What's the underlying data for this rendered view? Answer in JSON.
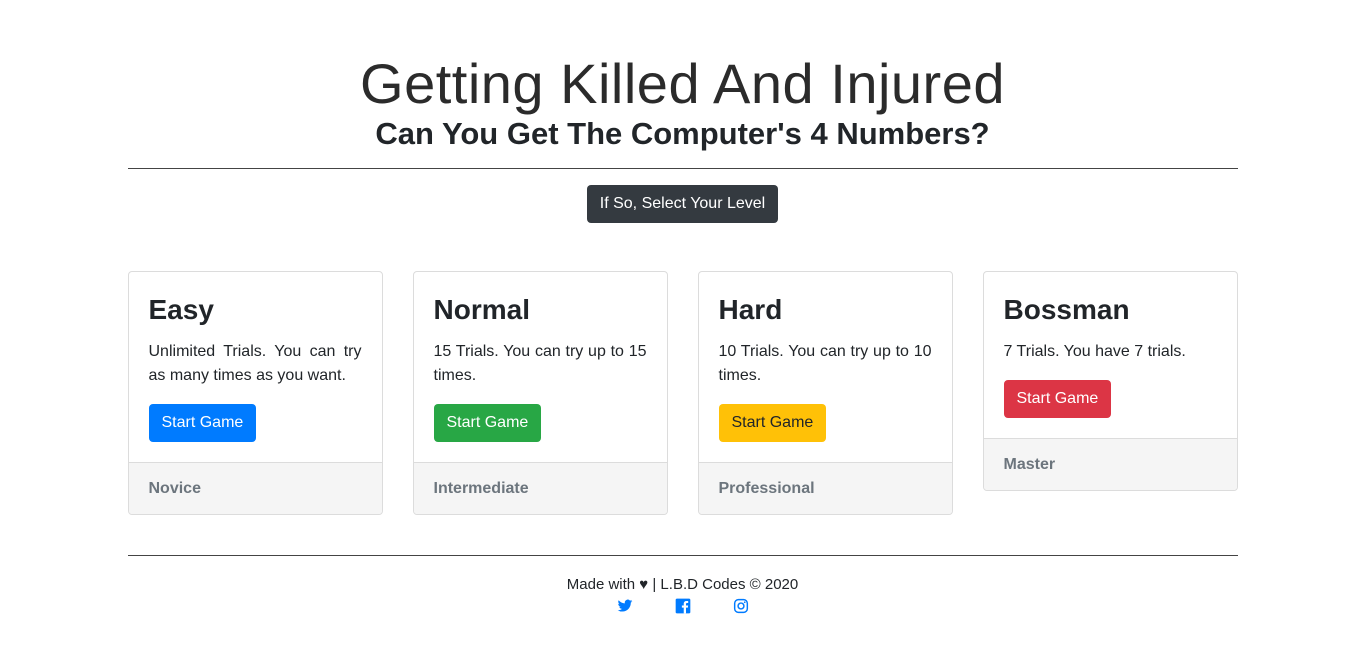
{
  "header": {
    "title": "Getting Killed And Injured",
    "subtitle": "Can You Get The Computer's 4 Numbers?"
  },
  "level_button": "If So, Select Your Level",
  "cards": [
    {
      "title": "Easy",
      "text": "Unlimited Trials. You can try as many times as you want.",
      "button": "Start Game",
      "footer": "Novice",
      "color": "#007bff"
    },
    {
      "title": "Normal",
      "text": "15 Trials. You can try up to 15 times.",
      "button": "Start Game",
      "footer": "Intermediate",
      "color": "#28a745"
    },
    {
      "title": "Hard",
      "text": "10 Trials. You can try up to 10 times.",
      "button": "Start Game",
      "footer": "Professional",
      "color": "#ffc107"
    },
    {
      "title": "Bossman",
      "text": "7 Trials. You have 7 trials.",
      "button": "Start Game",
      "footer": "Master",
      "color": "#dc3545"
    }
  ],
  "footer": {
    "text": "Made with ♥ | L.B.D Codes © 2020",
    "socials": [
      "twitter-icon",
      "facebook-icon",
      "instagram-icon"
    ],
    "social_color": "#007bff"
  }
}
